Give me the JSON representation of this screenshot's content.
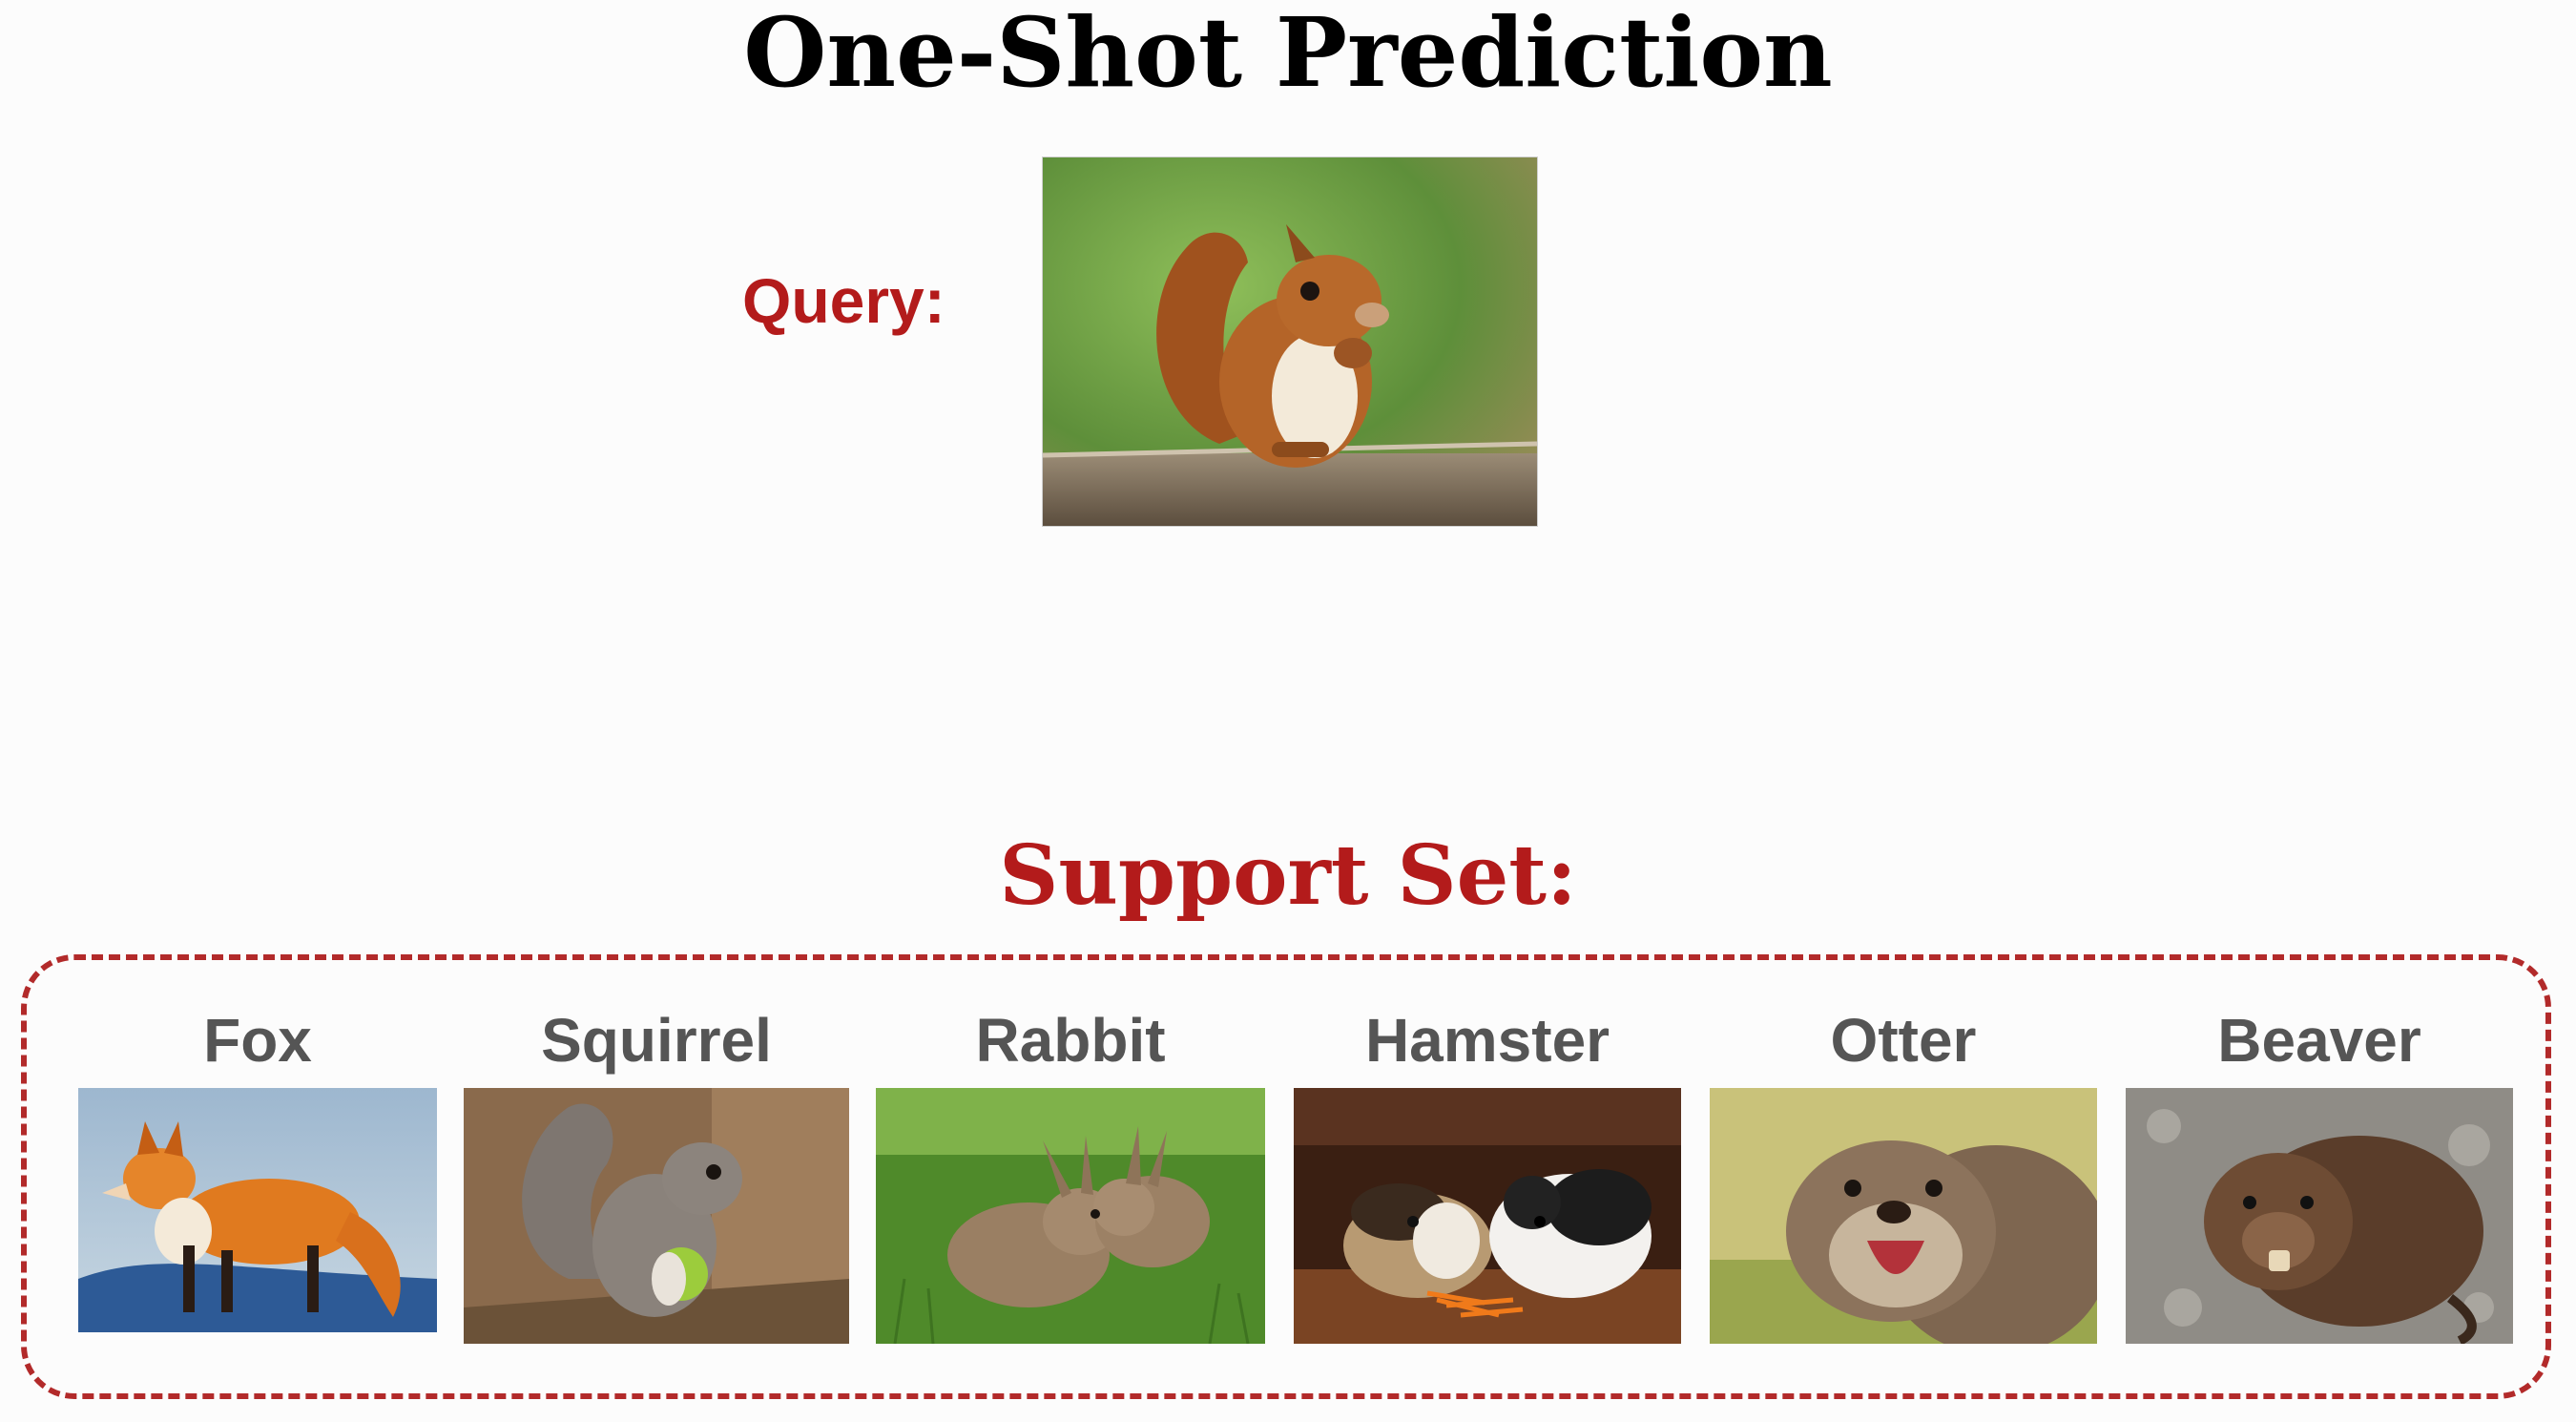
{
  "title": "One-Shot Prediction",
  "query": {
    "label": "Query:",
    "image": "red squirrel on a log (photo)"
  },
  "support_set": {
    "label": "Support Set:",
    "items": [
      {
        "label": "Fox"
      },
      {
        "label": "Squirrel"
      },
      {
        "label": "Rabbit"
      },
      {
        "label": "Hamster"
      },
      {
        "label": "Otter"
      },
      {
        "label": "Beaver"
      }
    ]
  },
  "colors": {
    "accent": "#b31b1b",
    "box_border": "#b22a2a",
    "label_gray": "#555555",
    "title": "#000000"
  }
}
